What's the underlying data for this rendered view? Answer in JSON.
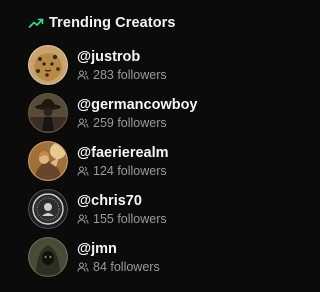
{
  "widget": {
    "title": "Trending Creators",
    "title_icon": "trending-up-icon",
    "accent_color": "#3ddc84",
    "creators": [
      {
        "handle": "@justrob",
        "followers": "283 followers",
        "avatar_icon": "leopard-avatar"
      },
      {
        "handle": "@germancowboy",
        "followers": "259 followers",
        "avatar_icon": "cowboy-avatar"
      },
      {
        "handle": "@faerierealm",
        "followers": "124 followers",
        "avatar_icon": "fairy-avatar"
      },
      {
        "handle": "@chris70",
        "followers": "155 followers",
        "avatar_icon": "emblem-avatar"
      },
      {
        "handle": "@jmn",
        "followers": "84 followers",
        "avatar_icon": "hooded-figure-avatar"
      }
    ],
    "followers_icon": "users-icon"
  }
}
